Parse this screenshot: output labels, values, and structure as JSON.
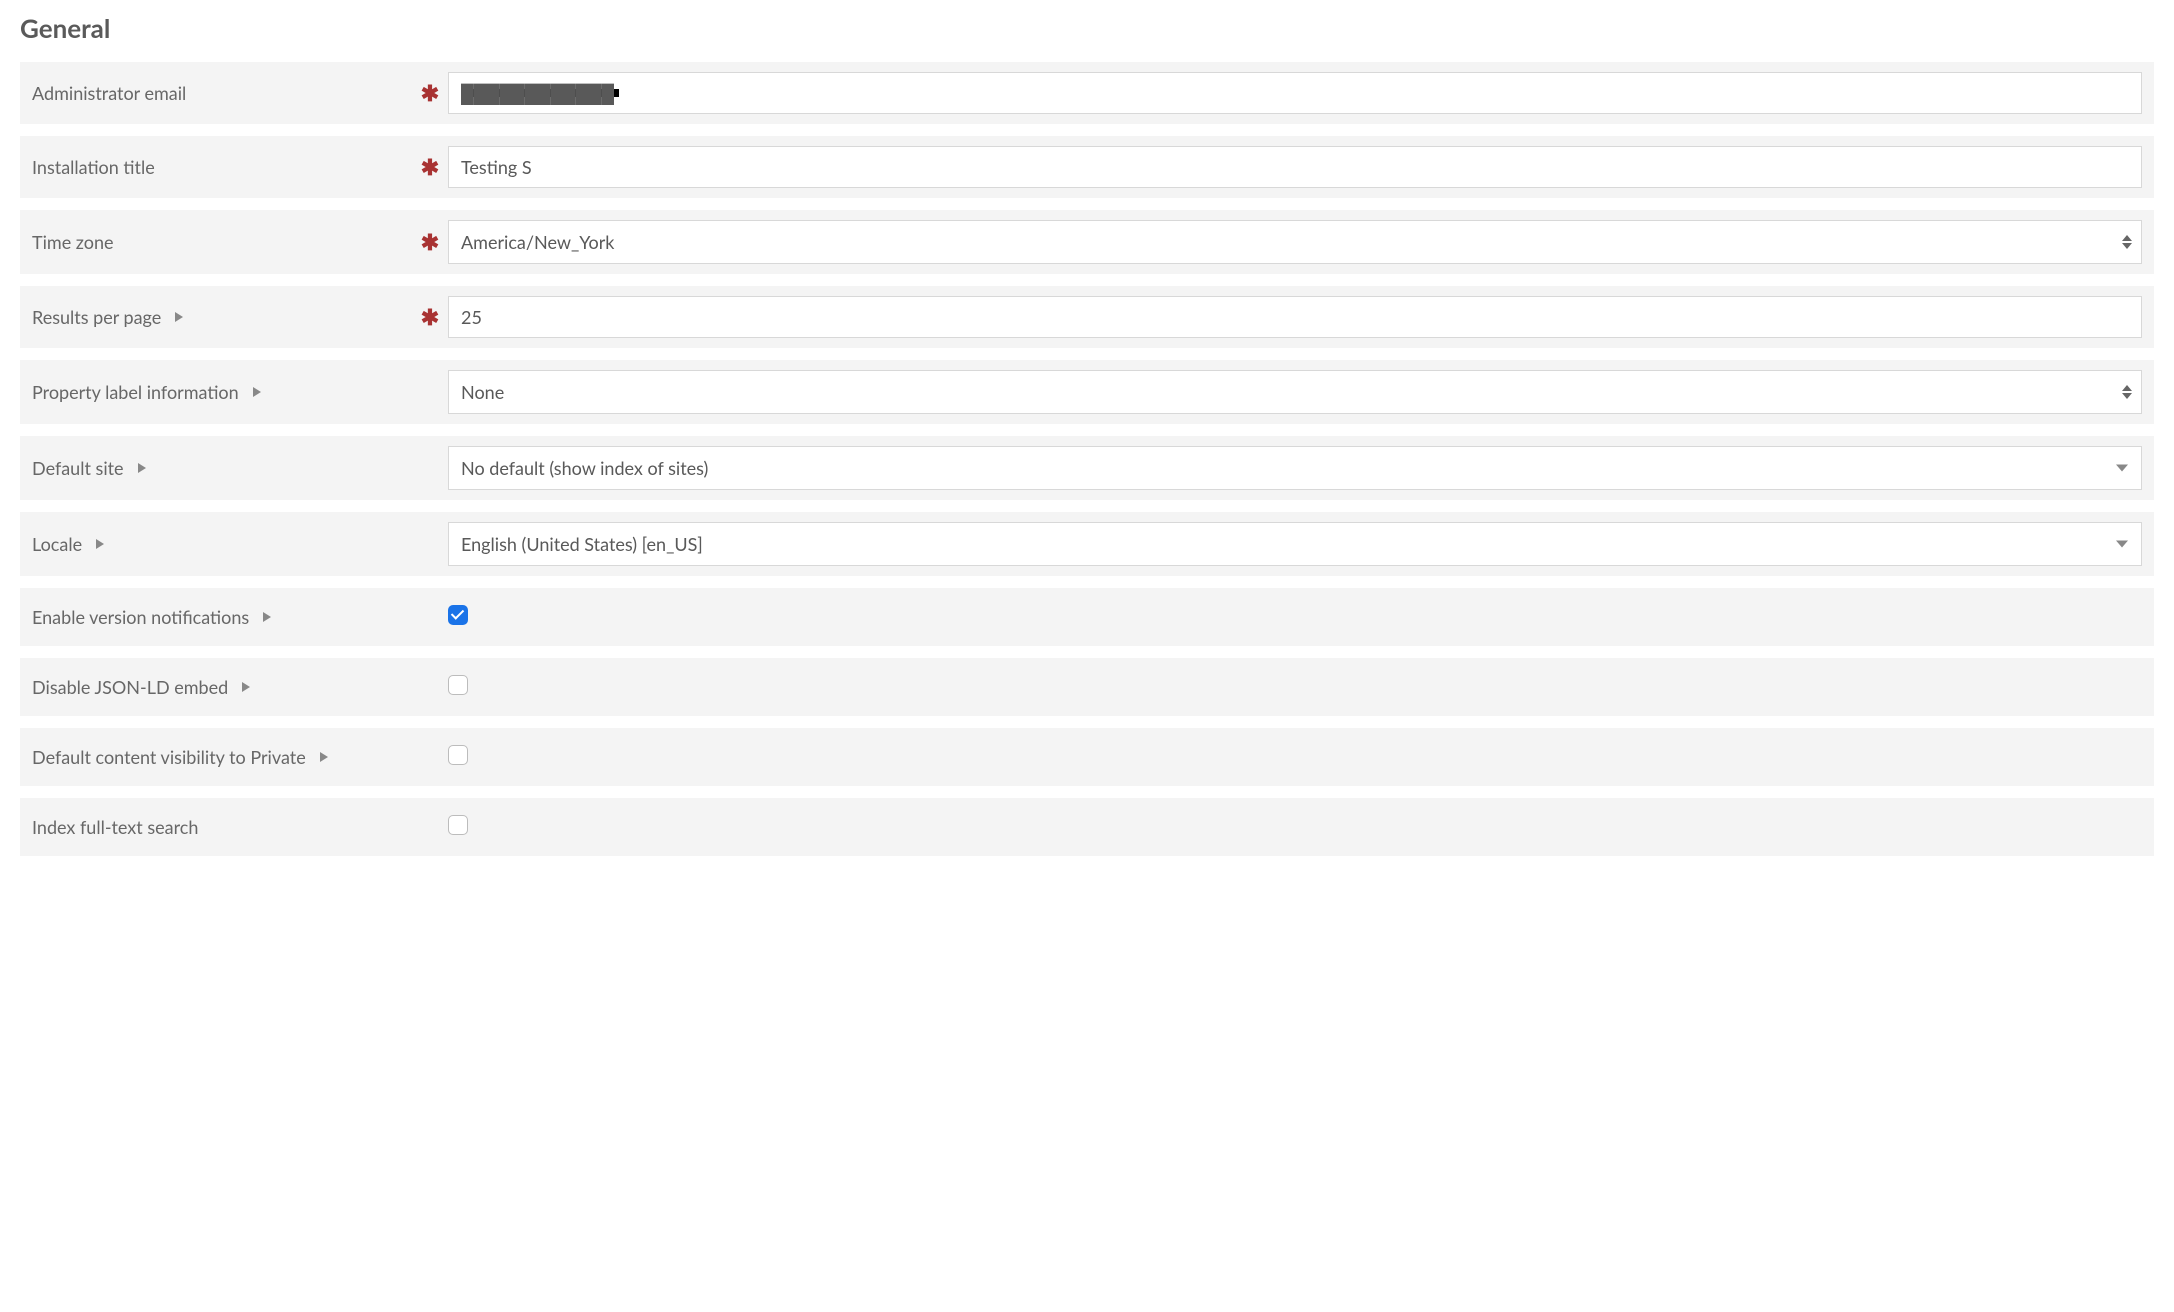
{
  "section_title": "General",
  "fields": {
    "admin_email": {
      "label": "Administrator email",
      "required": true,
      "value": "████████████"
    },
    "installation_title": {
      "label": "Installation title",
      "required": true,
      "value": "Testing S"
    },
    "time_zone": {
      "label": "Time zone",
      "required": true,
      "value": "America/New_York",
      "control": "select_sort"
    },
    "results_per_page": {
      "label": "Results per page",
      "required": true,
      "value": "25",
      "expandable": true
    },
    "property_label_info": {
      "label": "Property label information",
      "value": "None",
      "expandable": true,
      "control": "select_sort"
    },
    "default_site": {
      "label": "Default site",
      "value": "No default (show index of sites)",
      "expandable": true,
      "control": "select_caret"
    },
    "locale": {
      "label": "Locale",
      "value": "English (United States) [en_US]",
      "expandable": true,
      "control": "select_caret"
    },
    "enable_version_notifications": {
      "label": "Enable version notifications",
      "checked": true,
      "expandable": true,
      "control": "checkbox"
    },
    "disable_jsonld_embed": {
      "label": "Disable JSON-LD embed",
      "checked": false,
      "expandable": true,
      "control": "checkbox"
    },
    "default_content_private": {
      "label": "Default content visibility to Private",
      "checked": false,
      "expandable": true,
      "control": "checkbox"
    },
    "index_fulltext_search": {
      "label": "Index full-text search",
      "checked": false,
      "control": "checkbox"
    }
  },
  "required_glyph": "✱"
}
